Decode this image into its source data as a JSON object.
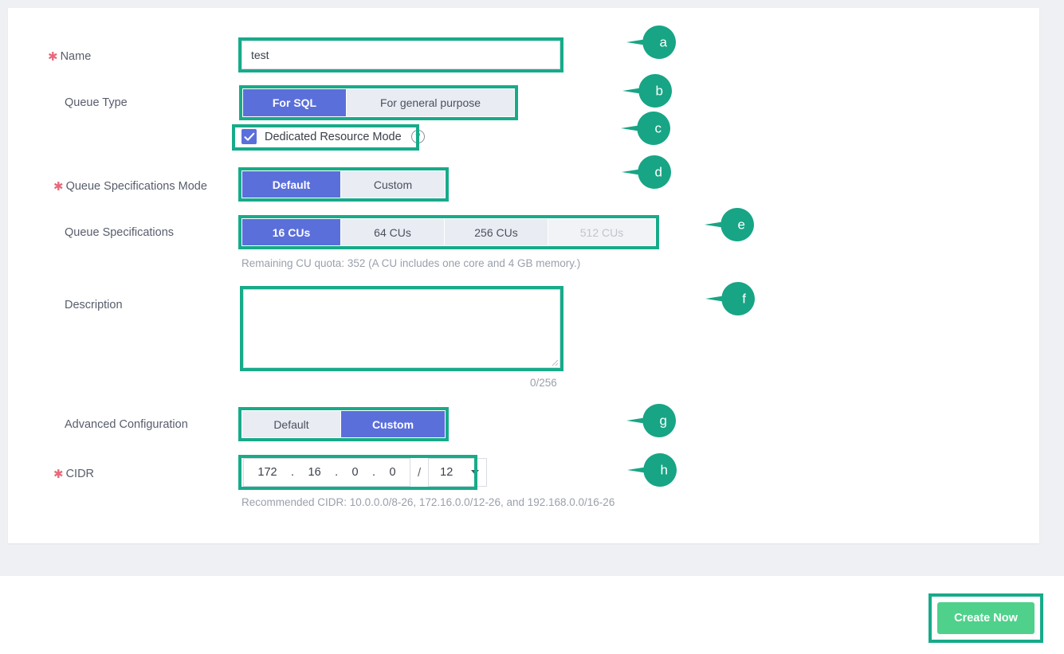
{
  "form": {
    "name": {
      "label": "Name",
      "required": true,
      "value": "test",
      "placeholder": ""
    },
    "queue_type": {
      "label": "Queue Type",
      "required": false,
      "options": [
        "For SQL",
        "For general purpose"
      ],
      "selected": "For SQL"
    },
    "dedicated_resource_mode": {
      "label": "Dedicated Resource Mode",
      "checked": true,
      "help_icon": "question-mark-circle-icon",
      "help_glyph": "?"
    },
    "queue_specifications_mode": {
      "label": "Queue Specifications Mode",
      "required": true,
      "options": [
        "Default",
        "Custom"
      ],
      "selected": "Default"
    },
    "queue_specifications": {
      "label": "Queue Specifications",
      "required": false,
      "options": [
        {
          "label": "16 CUs",
          "state": "selected"
        },
        {
          "label": "64 CUs",
          "state": "enabled"
        },
        {
          "label": "256 CUs",
          "state": "enabled"
        },
        {
          "label": "512 CUs",
          "state": "disabled"
        }
      ],
      "helper": "Remaining CU quota: 352 (A CU includes one core and 4 GB memory.)"
    },
    "description": {
      "label": "Description",
      "required": false,
      "value": "",
      "placeholder": "",
      "counter": "0/256"
    },
    "advanced_configuration": {
      "label": "Advanced Configuration",
      "required": false,
      "options": [
        "Default",
        "Custom"
      ],
      "selected": "Custom"
    },
    "cidr": {
      "label": "CIDR",
      "required": true,
      "octets": [
        "172",
        "16",
        "0",
        "0"
      ],
      "separator": ".",
      "slash": "/",
      "mask": "12",
      "helper": "Recommended CIDR: 10.0.0.0/8-26, 172.16.0.0/12-26, and 192.168.0.0/16-26"
    }
  },
  "footer": {
    "create_label": "Create Now"
  },
  "callouts": [
    {
      "letter": "a",
      "target": "name-input"
    },
    {
      "letter": "b",
      "target": "queue-type-segmented"
    },
    {
      "letter": "c",
      "target": "dedicated-resource-mode-checkbox"
    },
    {
      "letter": "d",
      "target": "queue-spec-mode-segmented"
    },
    {
      "letter": "e",
      "target": "queue-specifications-segmented"
    },
    {
      "letter": "f",
      "target": "description-textarea"
    },
    {
      "letter": "g",
      "target": "advanced-configuration-segmented"
    },
    {
      "letter": "h",
      "target": "cidr-input-group"
    }
  ],
  "colors": {
    "annotation": "#17ab8a",
    "segment_active": "#5b6fdb",
    "segment_inactive": "#e9ecf3",
    "required_star": "#e8687a",
    "create_button": "#4fd18b",
    "page_background": "#eef0f3"
  }
}
